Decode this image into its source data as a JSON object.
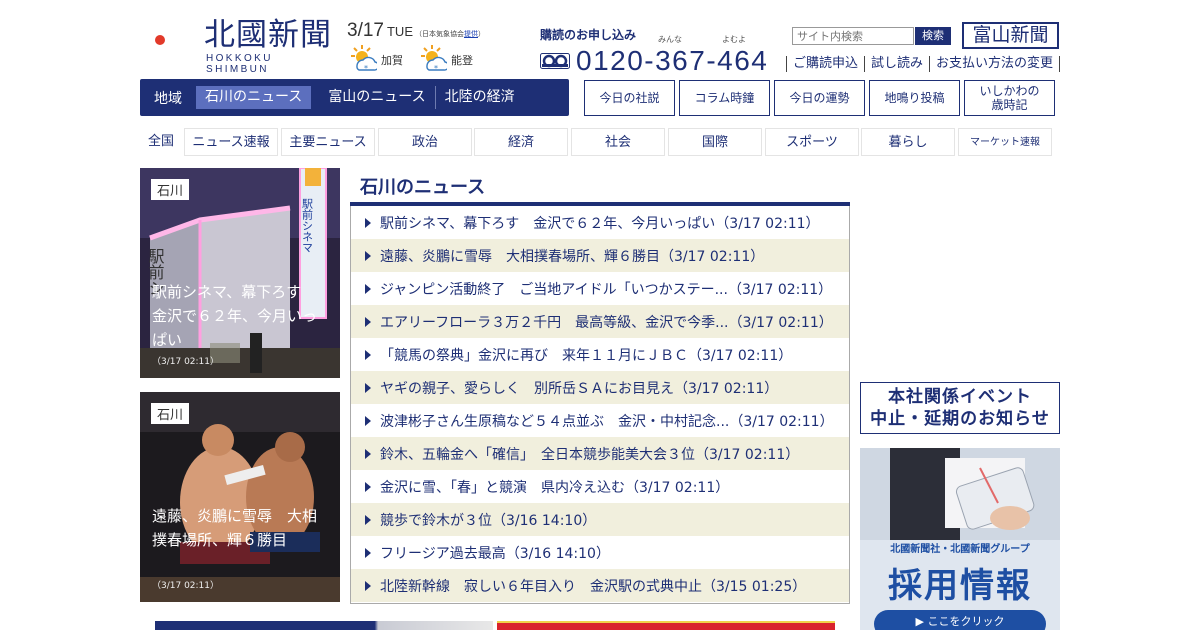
{
  "header": {
    "logo_title": "北國新聞",
    "logo_sub": "HOKKOKU SHIMBUN",
    "date": "3/17",
    "weekday": "TUE",
    "weather_source_prefix": "（日本気象協会",
    "weather_source_link": "提供",
    "weather_source_suffix": "）",
    "weather": [
      {
        "area": "加賀",
        "icon": "sun-snow-icon"
      },
      {
        "area": "能登",
        "icon": "sun-snow-icon"
      }
    ],
    "subscribe_label": "購読のお申し込み",
    "ruby_1": "みんな",
    "ruby_2": "よむよ",
    "phone_number": "0120-367-464",
    "search_placeholder": "サイト内検索",
    "search_button": "検索",
    "toyama_button": "富山新聞",
    "sub_links": [
      "ご購読申込",
      "試し読み",
      "お支払い方法の変更"
    ]
  },
  "region_nav": {
    "label": "地域",
    "tabs": [
      "石川のニュース",
      "富山のニュース",
      "北陸の経済"
    ],
    "active_index": 0
  },
  "feature_buttons": [
    "今日の社説",
    "コラム時鐘",
    "今日の運勢",
    "地鳴り投稿",
    "いしかわの\n歳時記"
  ],
  "categories": {
    "all_label": "全国",
    "items": [
      "ニュース速報",
      "主要ニュース",
      "政治",
      "経済",
      "社会",
      "国際",
      "スポーツ",
      "暮らし",
      "マーケット速報"
    ]
  },
  "photos": [
    {
      "badge": "石川",
      "caption": "駅前シネマ、幕下ろす　金沢で６２年、今月いっぱい",
      "time": "（3/17 02:11）"
    },
    {
      "badge": "石川",
      "caption": "遠藤、炎鵬に雪辱　大相撲春場所、輝６勝目",
      "time": "（3/17 02:11）"
    }
  ],
  "photo_signs": {
    "cinema_sign": "駅前シネマ",
    "cinema_side": "駅前シ"
  },
  "news": {
    "title": "石川のニュース",
    "items": [
      "駅前シネマ、幕下ろす　金沢で６２年、今月いっぱい（3/17 02:11）",
      "遠藤、炎鵬に雪辱　大相撲春場所、輝６勝目（3/17 02:11）",
      "ジャンピン活動終了　ご当地アイドル「いつかステー...（3/17 02:11）",
      "エアリーフローラ３万２千円　最高等級、金沢で今季...（3/17 02:11）",
      "「競馬の祭典」金沢に再び　来年１１月にＪＢＣ（3/17 02:11）",
      "ヤギの親子、愛らしく　別所岳ＳＡにお目見え（3/17 02:11）",
      "波津彬子さん生原稿など５４点並ぶ　金沢・中村記念...（3/17 02:11）",
      "鈴木、五輪金へ「確信」　全日本競歩能美大会３位（3/17 02:11）",
      "金沢に雪、「春」と競演　県内冷え込む（3/17 02:11）",
      "競歩で鈴木が３位（3/16 14:10）",
      "フリージア過去最高（3/16 14:10）",
      "北陸新幹線　寂しい６年目入り　金沢駅の式典中止（3/15 01:25）"
    ]
  },
  "notice": {
    "line1": "本社関係イベント",
    "line2": "中止・延期のお知らせ"
  },
  "recruit": {
    "sub": "北國新聞社・北國新聞グループ",
    "main": "採用情報",
    "button": "▶ ここをクリック"
  },
  "colors": {
    "brand_navy": "#1e2f75",
    "active_tab": "#5c6fbe",
    "stripe": "#f1efdd"
  }
}
